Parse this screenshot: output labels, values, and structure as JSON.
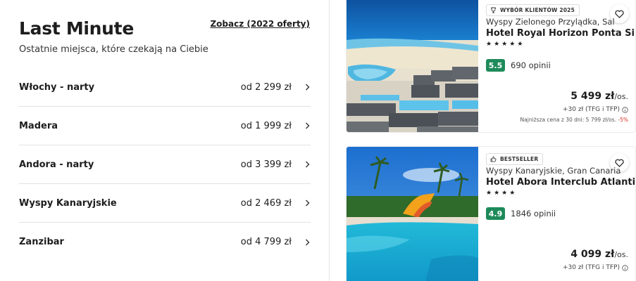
{
  "last_minute": {
    "title": "Last Minute",
    "subtitle": "Ostatnie miejsca, które czekają na Ciebie",
    "see_all": "Zobacz (2022 oferty)",
    "destinations": [
      {
        "name": "Włochy - narty",
        "price": "od 2 299 zł"
      },
      {
        "name": "Madera",
        "price": "od 1 999 zł"
      },
      {
        "name": "Andora - narty",
        "price": "od 3 399 zł"
      },
      {
        "name": "Wyspy Kanaryjskie",
        "price": "od 2 469 zł"
      },
      {
        "name": "Zanzibar",
        "price": "od 4 799 zł"
      }
    ]
  },
  "hotels": [
    {
      "badge": "WYBÓR KLIENTÓW 2025",
      "badge_icon": "trophy-icon",
      "location": "Wyspy Zielonego Przylądka, Sal",
      "name": "Hotel Royal Horizon Ponta Sino",
      "stars": 5,
      "score": "5.5",
      "reviews": "690 opinii",
      "price": "5 499 zł",
      "per": "/os.",
      "surcharge": "+30 zł (TFG i TFP)",
      "lowest_price": "Najniższa cena z 30 dni: 5 799 zł/os.",
      "discount": "-5%"
    },
    {
      "badge": "BESTSELLER",
      "badge_icon": "thumbs-up-icon",
      "location": "Wyspy Kanaryjskie, Gran Canaria",
      "name": "Hotel Abora Interclub Atlantic",
      "stars": 4,
      "score": "4.9",
      "reviews": "1846 opinii",
      "price": "4 099 zł",
      "per": "/os.",
      "surcharge": "+30 zł (TFG i TFP)"
    }
  ],
  "colors": {
    "score_green": "#1e8a5a",
    "discount_red": "#d93025"
  }
}
